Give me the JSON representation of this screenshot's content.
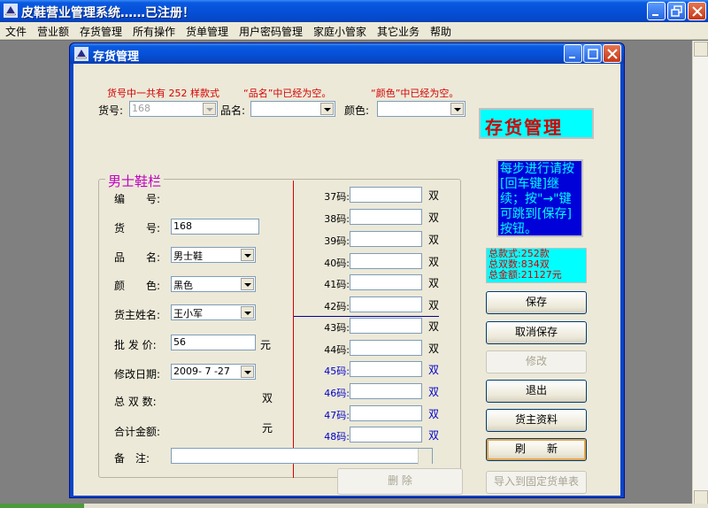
{
  "app": {
    "title": "皮鞋营业管理系统……已注册！"
  },
  "menu": [
    "文件",
    "营业额",
    "存货管理",
    "所有操作",
    "货单管理",
    "用户密码管理",
    "家庭小管家",
    "其它业务",
    "帮助"
  ],
  "window": {
    "title": "存货管理"
  },
  "header": {
    "notice_count": "货号中一共有 252 样款式",
    "notice_name": "“品名”中已经为空。",
    "notice_color": "“颜色”中已经为空。",
    "code_label": "货号:",
    "code_value": "168",
    "name_label": "品名:",
    "color_label": "颜色:",
    "banner": "存货管理"
  },
  "group": {
    "title": "男士鞋栏",
    "fields": {
      "number_label": "编　　号:",
      "code_label": "货　　号:",
      "code_value": "168",
      "name_label": "品　　名:",
      "name_value": "男士鞋",
      "color_label": "颜　　色:",
      "color_value": "黑色",
      "owner_label": "货主姓名:",
      "owner_value": "王小军",
      "price_label": "批 发 价:",
      "price_value": "56",
      "price_unit": "元",
      "date_label": "修改日期:",
      "date_value": "2009- 7 -27",
      "total_pairs_label": "总 双 数:",
      "total_pairs_unit": "双",
      "total_amount_label": "合计金额:",
      "total_amount_unit": "元",
      "remark_label": "备　注:"
    },
    "sizes": [
      {
        "label": "37码:",
        "unit": "双"
      },
      {
        "label": "38码:",
        "unit": "双"
      },
      {
        "label": "39码:",
        "unit": "双"
      },
      {
        "label": "40码:",
        "unit": "双"
      },
      {
        "label": "41码:",
        "unit": "双"
      },
      {
        "label": "42码:",
        "unit": "双"
      },
      {
        "label": "43码:",
        "unit": "双"
      },
      {
        "label": "44码:",
        "unit": "双"
      },
      {
        "label": "45码:",
        "unit": "双"
      },
      {
        "label": "46码:",
        "unit": "双"
      },
      {
        "label": "47码:",
        "unit": "双"
      },
      {
        "label": "48码:",
        "unit": "双"
      }
    ]
  },
  "side": {
    "note": "每步进行请按[回车键]继续；按\"→\"键可跳到[保存]按钮。",
    "summary_styles": "总款式:252款",
    "summary_pairs": "总双数:834双",
    "summary_amount": "总金额:21127元",
    "buttons": {
      "save": "保存",
      "cancel_save": "取消保存",
      "modify": "修改",
      "exit": "退出",
      "owner_info": "货主资料",
      "refresh": "刷　　新",
      "import": "导入到固定货单表"
    },
    "delete": "删 除"
  },
  "colors": {
    "accent_red": "#d40000",
    "banner_bg": "#00ffff",
    "note_bg": "#0000d8",
    "group_title": "#c000c0",
    "size_blue": "#0000c8"
  }
}
